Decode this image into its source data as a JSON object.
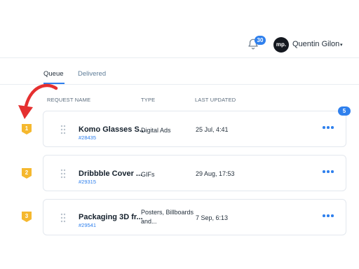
{
  "header": {
    "notifications_count": "30",
    "avatar_initials": "mp.",
    "user_name": "Quentin Gilon",
    "caret": "▾"
  },
  "tabs": [
    {
      "label": "Queue",
      "active": true
    },
    {
      "label": "Delivered",
      "active": false
    }
  ],
  "columns": {
    "name": "REQUEST NAME",
    "type": "TYPE",
    "updated": "LAST UPDATED"
  },
  "queue_badge": "5",
  "requests": [
    {
      "rank": "1",
      "title": "Komo Glasses S...",
      "id": "#28435",
      "type": "Digital Ads",
      "updated": "25 Jul, 4:41"
    },
    {
      "rank": "2",
      "title": "Dribbble Cover ...",
      "id": "#29315",
      "type": "GIFs",
      "updated": "29 Aug, 17:53"
    },
    {
      "rank": "3",
      "title": "Packaging 3D fr...",
      "id": "#29541",
      "type": "Posters, Billboards and...",
      "type_line1": "Posters, Billboards",
      "type_line2": "and...",
      "updated": "7 Sep, 6:13"
    }
  ],
  "colors": {
    "accent": "#2f80ed",
    "rank_badge": "#f5b82e",
    "annotation_arrow": "#e53030"
  }
}
